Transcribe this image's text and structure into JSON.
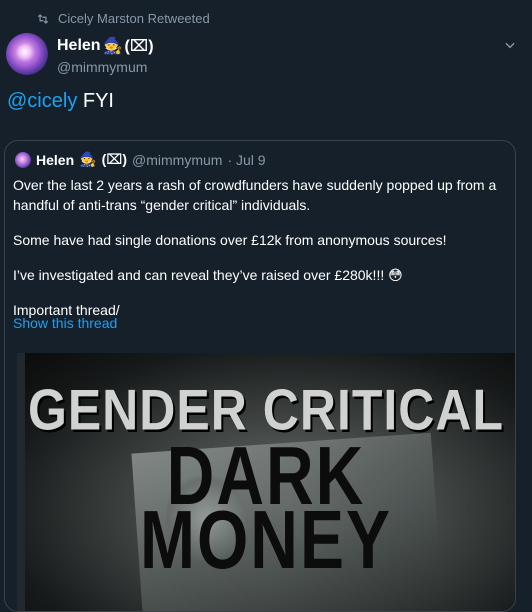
{
  "retweet": {
    "label": "Cicely Marston Retweeted",
    "icon": "retweet-icon"
  },
  "tweet": {
    "display_name": "Helen",
    "name_suffix": "(⌧)",
    "handle": "@mimmymum",
    "mention": "@cicely",
    "text": " FYI"
  },
  "quote": {
    "display_name": "Helen",
    "name_suffix": "(⌧)",
    "handle": "@mimmymum",
    "date": "· Jul 9",
    "paragraphs": [
      "Over the last 2 years a rash of crowdfunders have suddenly popped up from a handful of anti-trans “gender critical” individuals.",
      "Some have had single donations over £12k from anonymous sources!",
      "I’ve investigated and can reveal they’ve raised over £280k!!! 😳",
      "Important thread/"
    ],
    "show_thread": "Show this thread"
  },
  "media": {
    "line1": "GENDER CRITICAL",
    "line2": "DARK",
    "line3": "MONEY"
  },
  "colors": {
    "background": "#15202b",
    "accent": "#1da1f2",
    "muted": "#8899a6",
    "border": "#38444d"
  }
}
